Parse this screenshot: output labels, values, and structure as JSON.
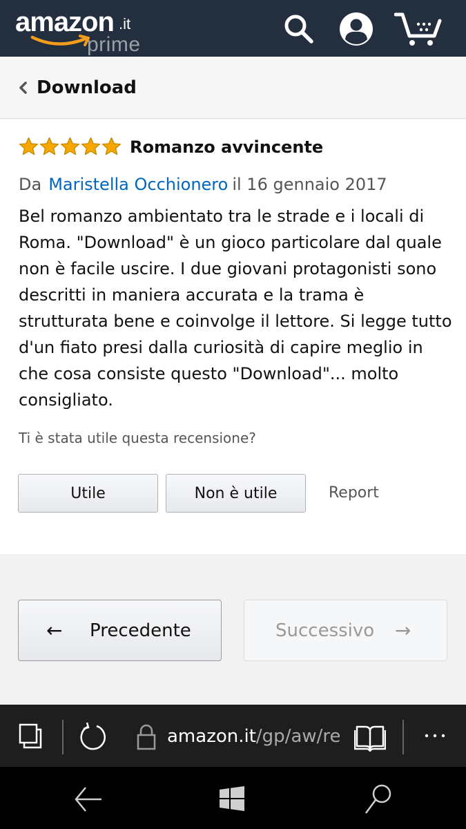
{
  "header": {
    "logo_word": "amazon",
    "logo_tld": ".it",
    "logo_sub": "prime",
    "icons": [
      "search-icon",
      "account-icon",
      "cart-icon"
    ],
    "bg_color": "#232f3e"
  },
  "subheader": {
    "back_icon": "chevron-left-icon",
    "title": "Download"
  },
  "review": {
    "rating": 5,
    "rating_max": 5,
    "star_color": "#f7a800",
    "title": "Romanzo avvincente",
    "by_prefix": "Da",
    "author": "Maristella Occhionero",
    "author_color": "#0066c0",
    "date": "il 16 gennaio 2017",
    "body": "Bel romanzo ambientato tra le strade e i locali di Roma. \"Download\" è un gioco particolare dal quale non è facile uscire. I due giovani protagonisti sono descritti in maniera accurata e la trama è strutturata bene e coinvolge il lettore. Si legge tutto d'un fiato presi dalla curiosità di capire meglio in che cosa consiste questo \"Download\"... molto consigliato.",
    "helpful_question": "Ti è stata utile questa recensione?",
    "helpful_label": "Utile",
    "not_helpful_label": "Non è utile",
    "report_label": "Report"
  },
  "pagination": {
    "prev_arrow": "←",
    "prev_label": "Precedente",
    "next_label": "Successivo",
    "next_arrow": "→",
    "next_disabled": true
  },
  "browser": {
    "url_domain": "amazon.it",
    "url_path": "/gp/aw/rev",
    "icons": [
      "tabs-icon",
      "refresh-icon",
      "lock-icon",
      "reading-view-icon",
      "more-icon"
    ],
    "more_label": "···"
  },
  "os_nav": {
    "icons": [
      "back-arrow-icon",
      "windows-start-icon",
      "search-icon"
    ]
  }
}
